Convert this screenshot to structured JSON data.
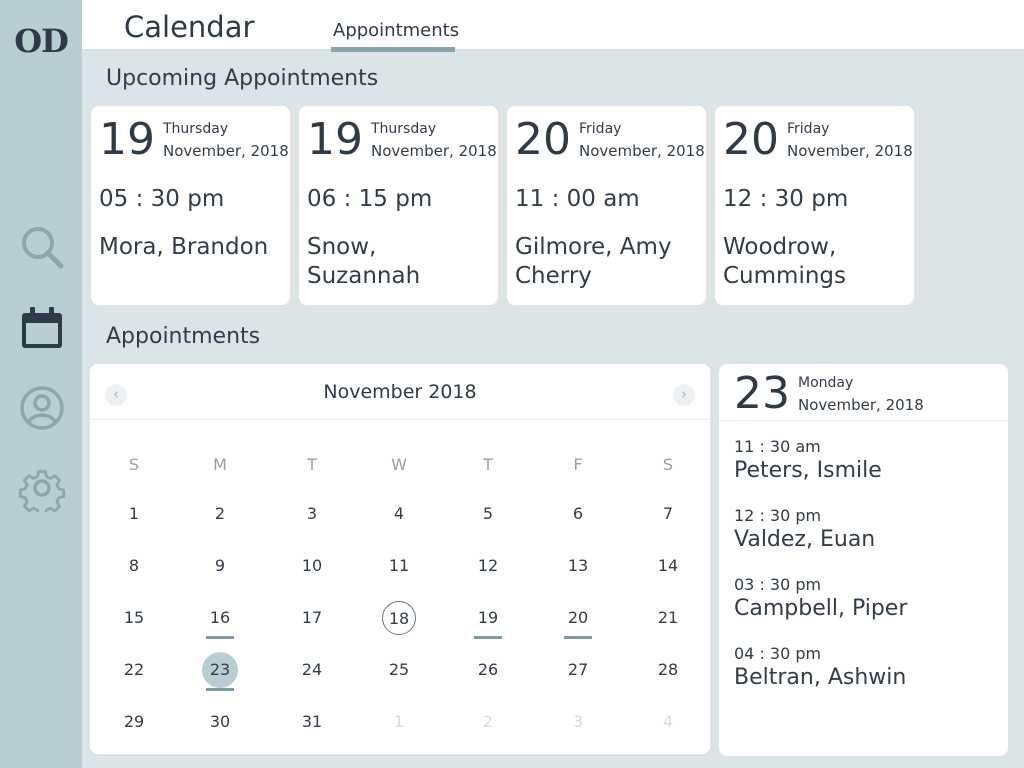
{
  "logo": {
    "text": "OD"
  },
  "nav": {
    "items": [
      {
        "name": "search",
        "icon": "search-icon"
      },
      {
        "name": "calendar",
        "icon": "calendar-icon",
        "active": true
      },
      {
        "name": "profile",
        "icon": "user-icon"
      },
      {
        "name": "settings",
        "icon": "gear-icon"
      }
    ]
  },
  "header": {
    "title": "Calendar",
    "tabs": [
      {
        "label": "Appointments",
        "active": true
      }
    ]
  },
  "upcoming": {
    "title": "Upcoming Appointments",
    "cards": [
      {
        "day": "19",
        "weekday": "Thursday",
        "monthyear": "November, 2018",
        "time": "05 : 30 pm",
        "patient": "Mora, Brandon"
      },
      {
        "day": "19",
        "weekday": "Thursday",
        "monthyear": "November, 2018",
        "time": "06 : 15 pm",
        "patient": "Snow, Suzannah"
      },
      {
        "day": "20",
        "weekday": "Friday",
        "monthyear": "November, 2018",
        "time": "11 : 00 am",
        "patient": "Gilmore, Amy Cherry"
      },
      {
        "day": "20",
        "weekday": "Friday",
        "monthyear": "November, 2018",
        "time": "12 : 30 pm",
        "patient": "Woodrow, Cummings"
      }
    ]
  },
  "appointments": {
    "title": "Appointments",
    "calendar": {
      "month_label": "November 2018",
      "prev_symbol": "‹",
      "next_symbol": "›",
      "weekdays": [
        "S",
        "M",
        "T",
        "W",
        "T",
        "F",
        "S"
      ],
      "weeks": [
        [
          "1",
          "2",
          "3",
          "4",
          "5",
          "6",
          "7"
        ],
        [
          "8",
          "9",
          "10",
          "11",
          "12",
          "13",
          "14"
        ],
        [
          "15",
          "16",
          "17",
          "18",
          "19",
          "20",
          "21"
        ],
        [
          "22",
          "23",
          "24",
          "25",
          "26",
          "27",
          "28"
        ],
        [
          "29",
          "30",
          "31",
          "1",
          "2",
          "3",
          "4"
        ]
      ],
      "today": "18",
      "selected": "23",
      "marked_days": [
        "16",
        "19",
        "20",
        "23"
      ],
      "next_month_days_in_last_week": 4
    },
    "day_panel": {
      "day": "23",
      "weekday": "Monday",
      "monthyear": "November, 2018",
      "items": [
        {
          "time": "11 : 30 am",
          "patient": "Peters, Ismile"
        },
        {
          "time": "12 : 30 pm",
          "patient": "Valdez, Euan"
        },
        {
          "time": "03 : 30 pm",
          "patient": "Campbell, Piper"
        },
        {
          "time": "04 : 30 pm",
          "patient": "Beltran, Ashwin"
        }
      ]
    }
  },
  "colors": {
    "sidebar": "#b9ced3",
    "background": "#dbe5e7",
    "accent": "#7f9ba2",
    "text": "#333c4a"
  }
}
